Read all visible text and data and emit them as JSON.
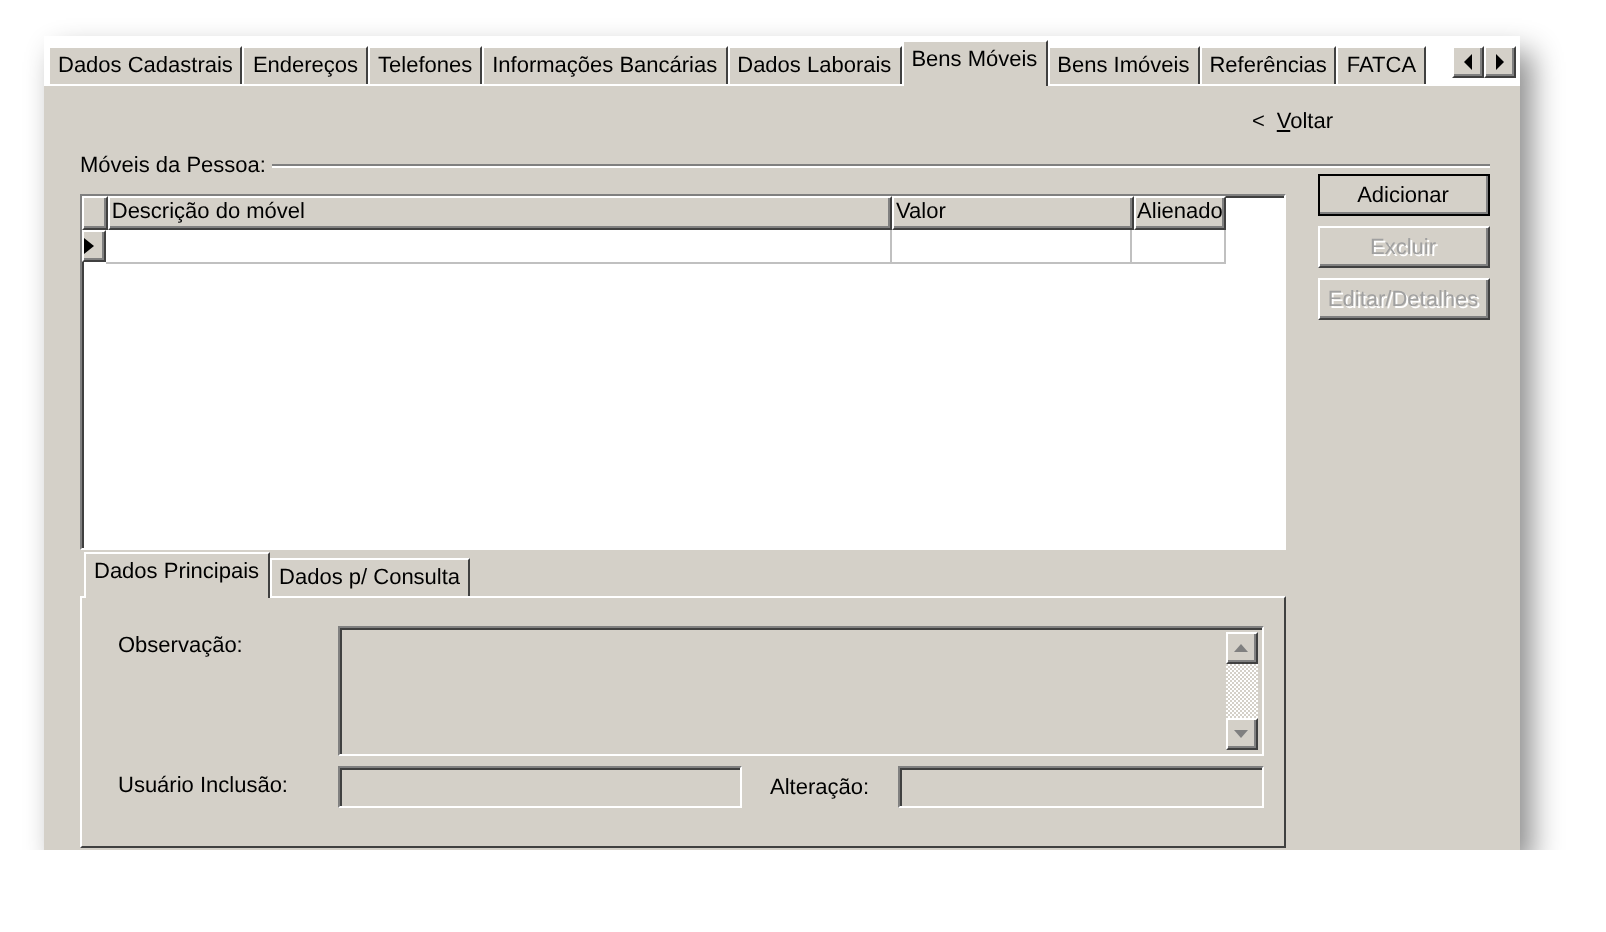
{
  "tabs": [
    {
      "label": "Dados Cadastrais",
      "selected": false
    },
    {
      "label": "Endereços",
      "selected": false
    },
    {
      "label": "Telefones",
      "selected": false
    },
    {
      "label": "Informações Bancárias",
      "selected": false
    },
    {
      "label": "Dados Laborais",
      "selected": false
    },
    {
      "label": "Bens Móveis",
      "selected": true
    },
    {
      "label": "Bens Imóveis",
      "selected": false
    },
    {
      "label": "Referências",
      "selected": false
    },
    {
      "label": "FATCA",
      "selected": false
    }
  ],
  "back_link": {
    "arrow": "<",
    "label": "Voltar"
  },
  "group_title": "Móveis da Pessoa:",
  "table": {
    "columns": [
      "Descrição do móvel",
      "Valor",
      "Alienado"
    ],
    "rows": [
      {
        "cells": [
          "",
          "",
          ""
        ],
        "current": true
      }
    ]
  },
  "buttons": [
    {
      "label": "Adicionar",
      "disabled": false
    },
    {
      "label": "Excluir",
      "disabled": true
    },
    {
      "label": "Editar/Detalhes",
      "disabled": true
    }
  ],
  "detail_tabs": [
    {
      "label": "Dados Principais",
      "selected": true
    },
    {
      "label": "Dados p/ Consulta",
      "selected": false
    }
  ],
  "fields": {
    "observacao": "Observação:",
    "usuario_inclusao": "Usuário Inclusão:",
    "alteracao": "Alteração:"
  }
}
